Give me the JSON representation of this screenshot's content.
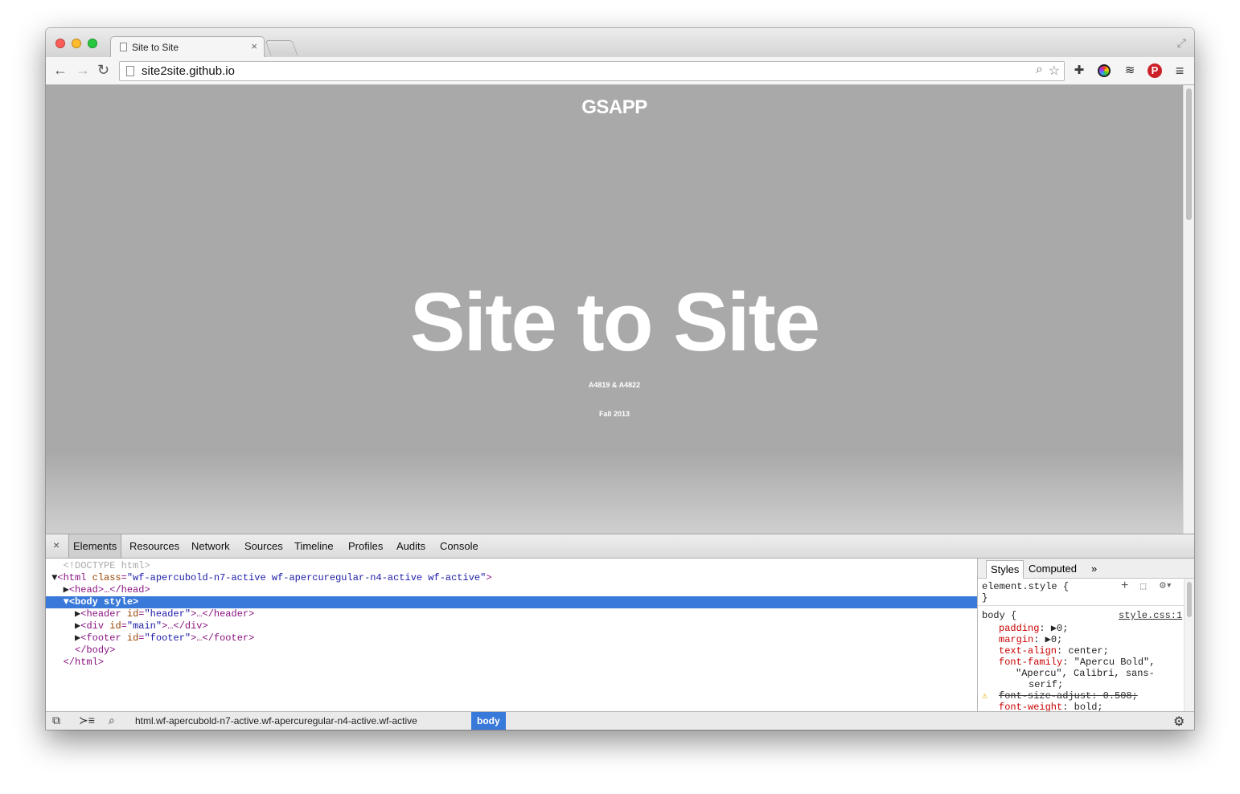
{
  "tab": {
    "title": "Site to Site",
    "close": "×"
  },
  "toolbar": {
    "url": "site2site.github.io"
  },
  "page": {
    "brand": "GSAPP",
    "title": "Site to Site",
    "course": "A4819 & A4822",
    "term": "Fall 2013"
  },
  "devtools": {
    "close": "×",
    "tabs": [
      "Elements",
      "Resources",
      "Network",
      "Sources",
      "Timeline",
      "Profiles",
      "Audits",
      "Console"
    ],
    "dom": {
      "doctype": "<!DOCTYPE html>",
      "html_open_tag": "<html",
      "html_class_attr": "class",
      "html_class_val": "\"wf-apercubold-n7-active wf-apercuregular-n4-active wf-active\"",
      "head": "<head>…</head>",
      "body_open": "<body style>",
      "header_tag": "<header",
      "header_attr": "id",
      "header_val": "\"header\"",
      "header_close": ">…</header>",
      "div_tag": "<div",
      "div_attr": "id",
      "div_val": "\"main\"",
      "div_close": ">…</div>",
      "footer_tag": "<footer",
      "footer_attr": "id",
      "footer_val": "\"footer\"",
      "footer_close": ">…</footer>",
      "body_close": "</body>",
      "html_close": "</html>"
    },
    "styles": {
      "tabs": [
        "Styles",
        "Computed"
      ],
      "more": "»",
      "element_style": "element.style {",
      "brace_close": "}",
      "selector": "body {",
      "source": "style.css:1",
      "props": [
        {
          "name": "padding",
          "value": "▶0;"
        },
        {
          "name": "margin",
          "value": "▶0;"
        },
        {
          "name": "text-align",
          "value": "center;"
        },
        {
          "name": "font-family",
          "value": "\"Apercu Bold\","
        }
      ],
      "font_cont1": "\"Apercu\", Calibri, sans-",
      "font_cont2": "serif;",
      "strike": "font-size-adjust: 0.508;",
      "last_name": "font-weight",
      "last_value": "bold;"
    },
    "breadcrumbs": [
      "html.wf-apercubold-n7-active.wf-apercuregular-n4-active.wf-active",
      "body"
    ]
  }
}
